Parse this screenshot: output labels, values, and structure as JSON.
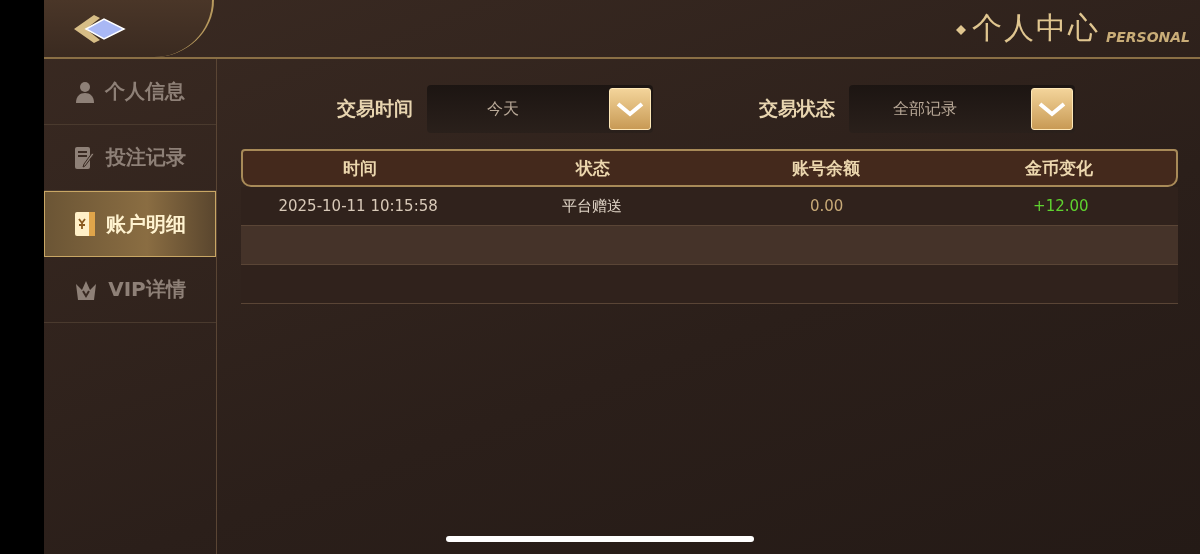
{
  "header": {
    "title": "个人中心",
    "subtitle": "PERSONAL"
  },
  "sidebar": {
    "items": [
      {
        "label": "个人信息",
        "selected": false
      },
      {
        "label": "投注记录",
        "selected": false
      },
      {
        "label": "账户明细",
        "selected": true
      },
      {
        "label": "VIP详情",
        "selected": false
      }
    ]
  },
  "filters": [
    {
      "label": "交易时间",
      "value": "今天"
    },
    {
      "label": "交易状态",
      "value": "全部记录"
    }
  ],
  "table": {
    "columns": [
      "时间",
      "状态",
      "账号余额",
      "金币变化"
    ],
    "rows": [
      [
        "2025-10-11 10:15:58",
        "平台赠送",
        "0.00",
        "+12.00"
      ]
    ]
  }
}
